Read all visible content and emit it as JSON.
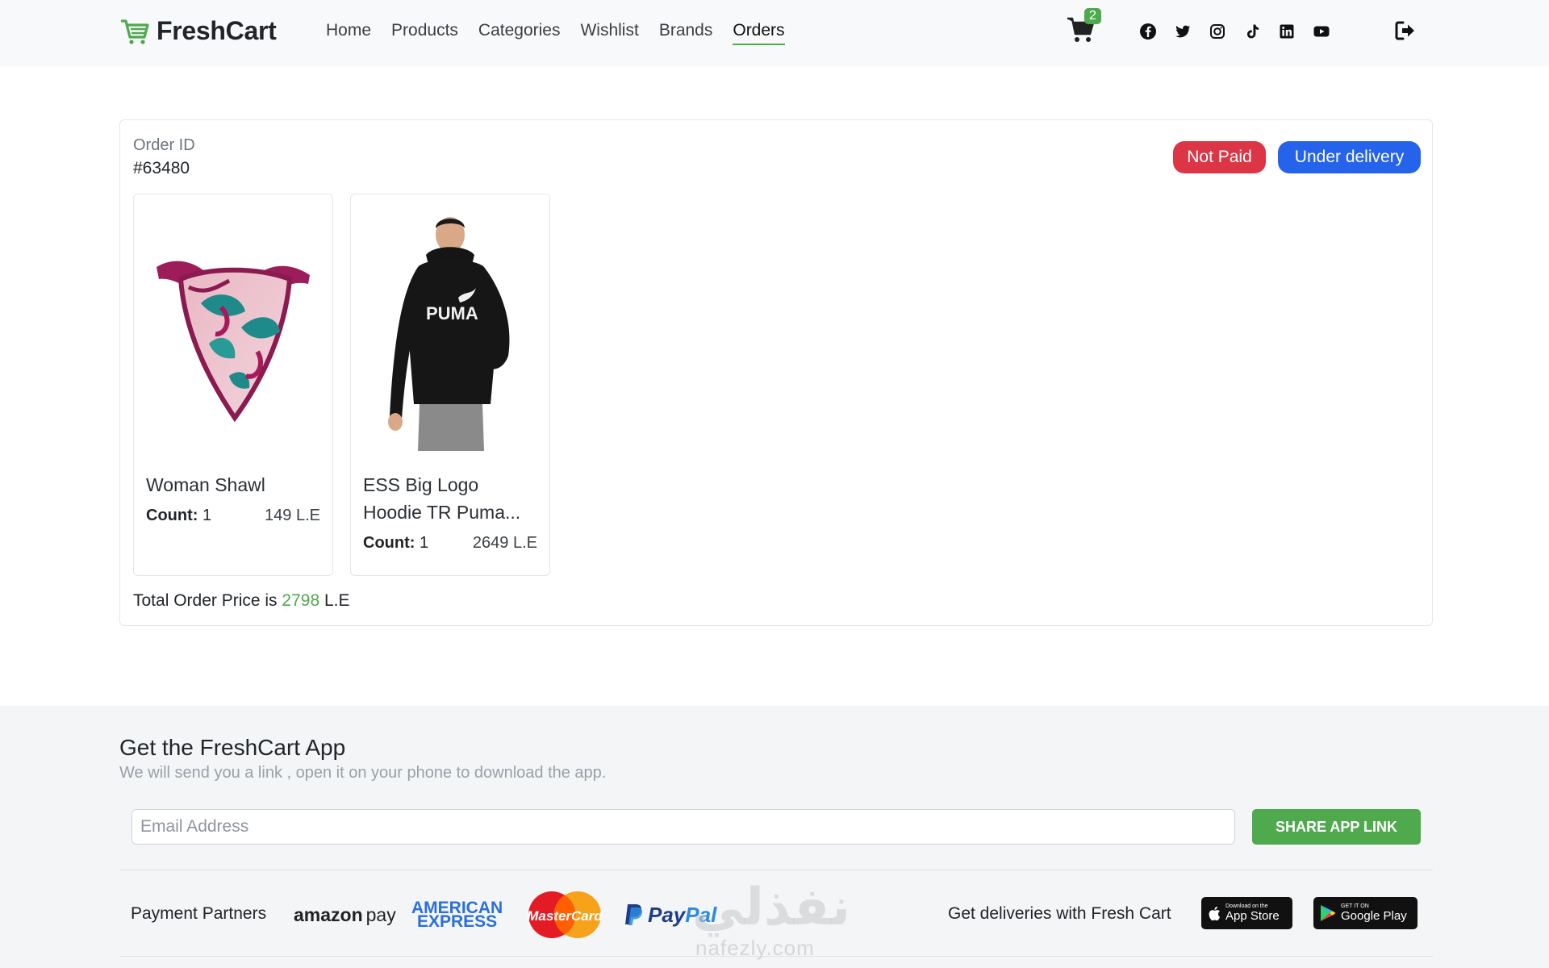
{
  "navbar": {
    "brand": "FreshCart",
    "links": [
      {
        "label": "Home"
      },
      {
        "label": "Products"
      },
      {
        "label": "Categories"
      },
      {
        "label": "Wishlist"
      },
      {
        "label": "Brands"
      },
      {
        "label": "Orders",
        "active": true
      }
    ],
    "cart_count": "2",
    "socials": [
      "facebook-icon",
      "twitter-icon",
      "instagram-icon",
      "tiktok-icon",
      "linkedin-icon",
      "youtube-icon"
    ],
    "logout_icon": "logout-icon"
  },
  "order": {
    "id_label": "Order ID",
    "id": "#63480",
    "payment_status": "Not Paid",
    "delivery_status": "Under delivery",
    "items": [
      {
        "name": "Woman Shawl",
        "count_label": "Count:",
        "count": "1",
        "price": "149 L.E"
      },
      {
        "name": "ESS Big Logo Hoodie TR Puma...",
        "count_label": "Count:",
        "count": "1",
        "price": "2649 L.E"
      }
    ],
    "total_prefix": "Total Order Price is",
    "total_value": "2798",
    "total_suffix": "L.E"
  },
  "footer": {
    "title": "Get the FreshCart App",
    "subtitle": "We will send you a link , open it on your phone to download the app.",
    "email_placeholder": "Email Address",
    "share_button": "SHARE APP LINK",
    "partners_label": "Payment Partners",
    "partners": {
      "amazon": "amazon",
      "amazon_pay": "pay",
      "amex_line1": "AMERICAN",
      "amex_line2": "EXPRESS",
      "mastercard": "MasterCard",
      "paypal_pay": "Pay",
      "paypal_pal": "Pal"
    },
    "deliveries_label": "Get deliveries with Fresh Cart",
    "appstore_small": "Download on the",
    "appstore_big": "App Store",
    "googleplay_small": "GET IT ON",
    "googleplay_big": "Google Play"
  },
  "watermark": {
    "arabic": "نفذلي",
    "latin": "nafezly.com"
  },
  "colors": {
    "brand_green": "#4fa94d",
    "danger": "#dc3545",
    "primary": "#2563eb"
  }
}
